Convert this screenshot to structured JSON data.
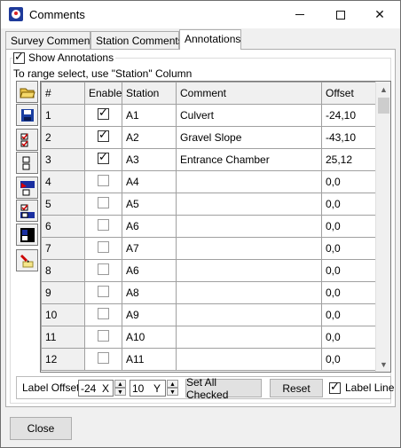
{
  "window": {
    "title": "Comments"
  },
  "tabs": [
    {
      "label": "Survey Comments"
    },
    {
      "label": "Station Comments"
    },
    {
      "label": "Annotations",
      "active": true
    }
  ],
  "annotations": {
    "show_label": "Show Annotations",
    "show_checked": true,
    "range_hint": "To range select, use \"Station\" Column"
  },
  "toolbar": {
    "icons": [
      "open-folder-icon",
      "save-icon",
      "check-items-icon",
      "uncheck-items-icon",
      "color-flag-icon",
      "color-check-icon",
      "color-block-icon",
      "highlighter-icon"
    ]
  },
  "grid": {
    "columns": [
      "#",
      "Enable",
      "Station",
      "Comment",
      "Offset"
    ],
    "rows": [
      {
        "num": "1",
        "enabled": true,
        "station": "A1",
        "comment": "Culvert",
        "offset": "-24,10"
      },
      {
        "num": "2",
        "enabled": true,
        "station": "A2",
        "comment": "Gravel Slope",
        "offset": "-43,10"
      },
      {
        "num": "3",
        "enabled": true,
        "station": "A3",
        "comment": "Entrance Chamber",
        "offset": "25,12"
      },
      {
        "num": "4",
        "enabled": false,
        "station": "A4",
        "comment": "",
        "offset": "0,0"
      },
      {
        "num": "5",
        "enabled": false,
        "station": "A5",
        "comment": "",
        "offset": "0,0"
      },
      {
        "num": "6",
        "enabled": false,
        "station": "A6",
        "comment": "",
        "offset": "0,0"
      },
      {
        "num": "7",
        "enabled": false,
        "station": "A7",
        "comment": "",
        "offset": "0,0"
      },
      {
        "num": "8",
        "enabled": false,
        "station": "A6",
        "comment": "",
        "offset": "0,0"
      },
      {
        "num": "9",
        "enabled": false,
        "station": "A8",
        "comment": "",
        "offset": "0,0"
      },
      {
        "num": "10",
        "enabled": false,
        "station": "A9",
        "comment": "",
        "offset": "0,0"
      },
      {
        "num": "11",
        "enabled": false,
        "station": "A10",
        "comment": "",
        "offset": "0,0"
      },
      {
        "num": "12",
        "enabled": false,
        "station": "A11",
        "comment": "",
        "offset": "0,0"
      }
    ]
  },
  "bottom": {
    "label_offset": "Label Offset",
    "offset_x": "-24",
    "offset_x_unit": "X",
    "offset_y": "10",
    "offset_y_unit": "Y",
    "set_all_checked": "Set All Checked",
    "reset": "Reset",
    "label_line": "Label Line",
    "label_line_checked": true
  },
  "footer": {
    "close": "Close"
  }
}
